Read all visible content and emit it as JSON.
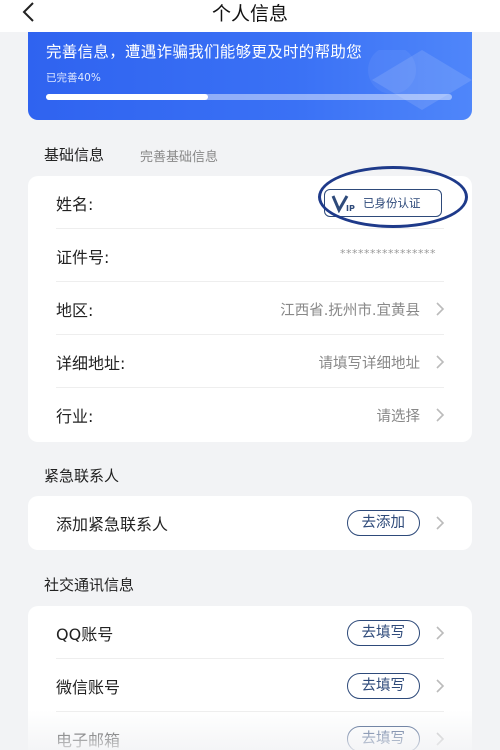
{
  "header": {
    "title": "个人信息",
    "back_icon": "chevron-left-icon"
  },
  "banner": {
    "message": "完善信息，遭遇诈骗我们能够更及时的帮助您",
    "progress_label": "已完善40%",
    "progress_fraction": 0.4,
    "color": "#2f63f0"
  },
  "basic": {
    "title": "基础信息",
    "subtitle": "完善基础信息",
    "name_label": "姓名:",
    "vip_badge_text": "已身份认证",
    "id_label": "证件号:",
    "id_value": "****************",
    "region_label": "地区:",
    "region_value": "江西省.抚州市.宜黄县",
    "address_label": "详细地址:",
    "address_placeholder": "请填写详细地址",
    "industry_label": "行业:",
    "industry_placeholder": "请选择"
  },
  "emergency": {
    "title": "紧急联系人",
    "add_label": "添加紧急联系人",
    "add_button": "去添加"
  },
  "social": {
    "title": "社交通讯信息",
    "qq_label": "QQ账号",
    "qq_button": "去填写",
    "wechat_label": "微信账号",
    "wechat_button": "去填写",
    "email_label": "电子邮箱",
    "email_button": "去填写"
  }
}
